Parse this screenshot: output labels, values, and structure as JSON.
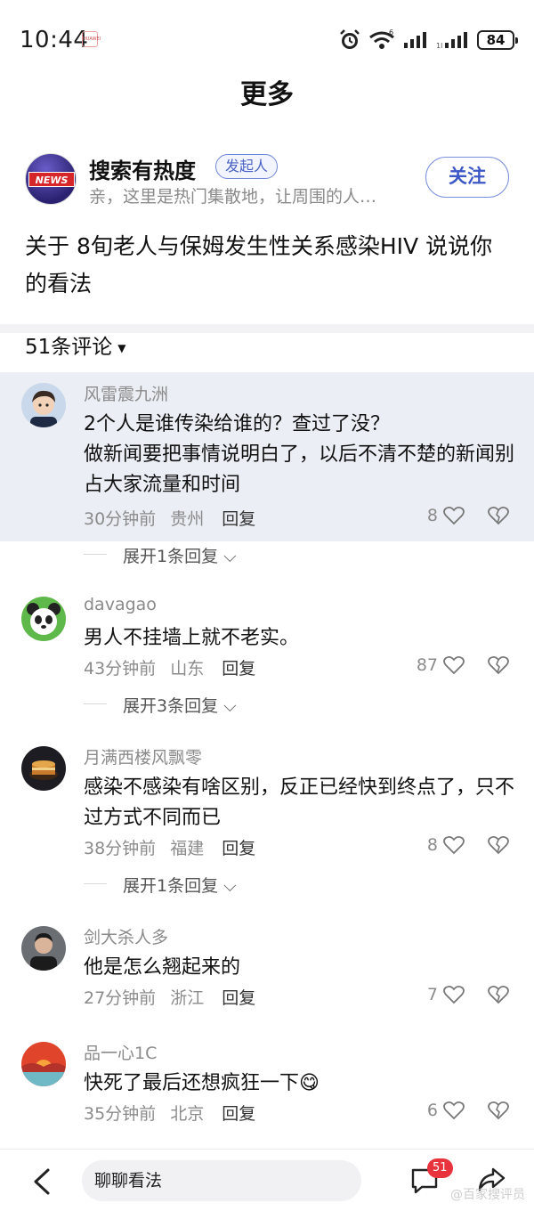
{
  "status_bar": {
    "time": "10:44",
    "carrier_label": "HUAWEI",
    "battery": "84",
    "wifi_label": "6",
    "signal_label": "1l"
  },
  "header": {
    "title": "更多"
  },
  "author": {
    "name": "搜索有热度",
    "badge": "发起人",
    "desc": "亲，这里是热门集散地，让周围的人…",
    "follow_label": "关注",
    "avatar_label": "NEWS"
  },
  "topic": {
    "text": "关于 8旬老人与保姆发生性关系感染HIV 说说你的看法"
  },
  "comments_header": {
    "count_label": "51条评论"
  },
  "comments": [
    {
      "name": "风雷震九洲",
      "text": "2个人是谁传染给谁的？查过了没？\n做新闻要把事情说明白了，以后不清不楚的新闻别占大家流量和时间",
      "time": "30分钟前",
      "location": "贵州",
      "reply": "回复",
      "likes": "8",
      "expand": "展开1条回复"
    },
    {
      "name": "davagao",
      "text": "男人不挂墙上就不老实。",
      "time": "43分钟前",
      "location": "山东",
      "reply": "回复",
      "likes": "87",
      "expand": "展开3条回复"
    },
    {
      "name": "月满西楼风飘零",
      "text": "感染不感染有啥区别，反正已经快到终点了，只不过方式不同而已",
      "time": "38分钟前",
      "location": "福建",
      "reply": "回复",
      "likes": "8",
      "expand": "展开1条回复"
    },
    {
      "name": "剑大杀人多",
      "text": "他是怎么翘起来的",
      "time": "27分钟前",
      "location": "浙江",
      "reply": "回复",
      "likes": "7"
    },
    {
      "name": "品一心1C",
      "text": "快死了最后还想疯狂一下😋",
      "time": "35分钟前",
      "location": "北京",
      "reply": "回复",
      "likes": "6"
    }
  ],
  "bottom_bar": {
    "input_placeholder": "聊聊看法",
    "message_count": "51",
    "watermark": "@百家搜评员"
  },
  "colors": {
    "accent": "#3c58c6",
    "highlight_bg": "#eceef5",
    "badge_red": "#e8333c"
  }
}
